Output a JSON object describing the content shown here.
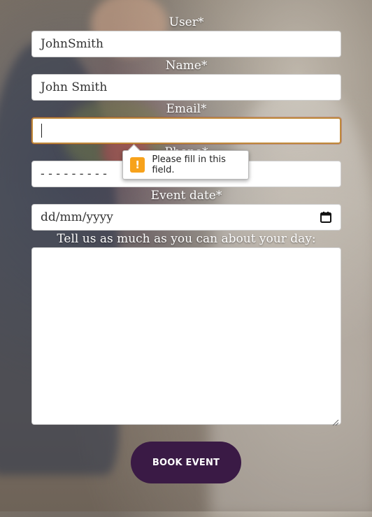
{
  "form": {
    "user": {
      "label": "User*",
      "value": "JohnSmith"
    },
    "name": {
      "label": "Name*",
      "value": "John Smith"
    },
    "email": {
      "label": "Email*",
      "value": ""
    },
    "phone": {
      "label": "Phone*",
      "value": "- - - - - - - - -"
    },
    "event_date": {
      "label": "Event date*",
      "value": "dd/mm/yyyy"
    },
    "details": {
      "label": "Tell us as much as you can about your day:",
      "value": ""
    }
  },
  "validation_tooltip": {
    "message": "Please fill in this field.",
    "icon": "warning-icon"
  },
  "submit": {
    "label": "BOOK EVENT"
  },
  "colors": {
    "button_bg": "#3a1a45",
    "focus_border": "#c08a3a",
    "warning_icon_bg": "#f7a21b"
  }
}
